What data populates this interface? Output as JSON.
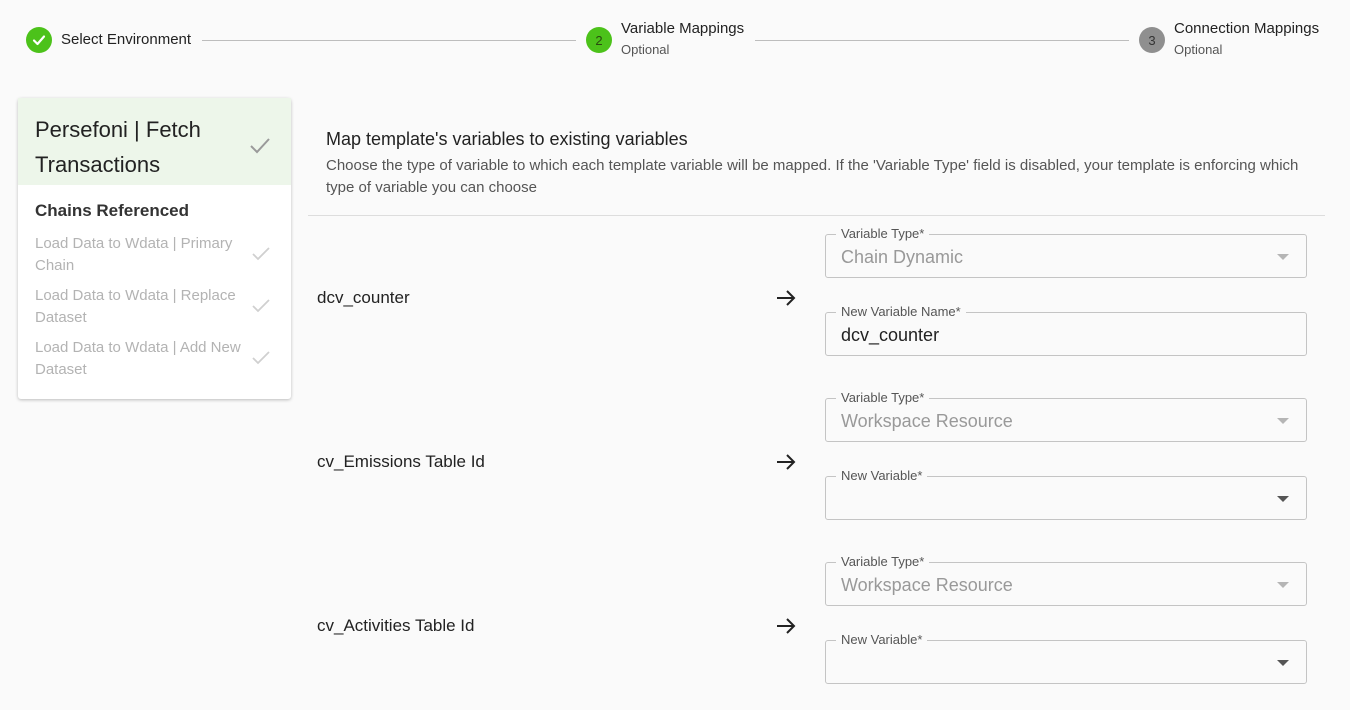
{
  "stepper": {
    "steps": [
      {
        "label": "Select Environment",
        "sub": ""
      },
      {
        "label": "Variable Mappings",
        "sub": "Optional",
        "number": "2"
      },
      {
        "label": "Connection Mappings",
        "sub": "Optional",
        "number": "3"
      }
    ]
  },
  "sidebar": {
    "title": "Persefoni | Fetch Transactions",
    "section": "Chains Referenced",
    "items": [
      {
        "label": "Load Data to Wdata | Primary Chain"
      },
      {
        "label": "Load Data to Wdata | Replace Dataset"
      },
      {
        "label": "Load Data to Wdata | Add New Dataset"
      }
    ]
  },
  "main": {
    "title": "Map template's variables to existing variables",
    "description": "Choose the type of variable to which each template variable will be mapped. If the 'Variable Type' field is disabled, your template is enforcing which type of variable you can choose",
    "mappings": [
      {
        "name": "dcv_counter",
        "type_label": "Variable Type*",
        "type_value": "Chain Dynamic",
        "second_label": "New Variable Name*",
        "second_value": "dcv_counter"
      },
      {
        "name": "cv_Emissions Table Id",
        "type_label": "Variable Type*",
        "type_value": "Workspace Resource",
        "second_label": "New Variable*",
        "second_value": ""
      },
      {
        "name": "cv_Activities Table Id",
        "type_label": "Variable Type*",
        "type_value": "Workspace Resource",
        "second_label": "New Variable*",
        "second_value": ""
      }
    ]
  },
  "colors": {
    "accent": "#4cc21a",
    "sidebar_head_bg": "#edf6ea"
  }
}
